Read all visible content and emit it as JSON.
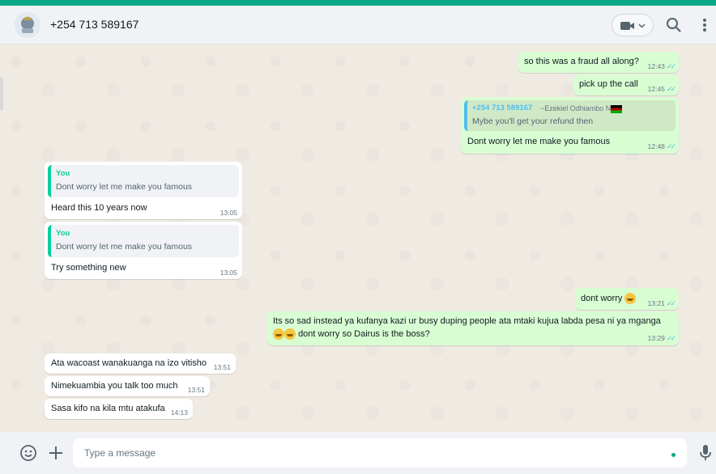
{
  "header": {
    "contact_name": "+254 713 589167",
    "icons": [
      "avatar-emblem",
      "video-call-icon",
      "chevron-down-icon",
      "search-icon",
      "menu-icon"
    ]
  },
  "messages": [
    {
      "direction": "outgoing",
      "text": "so this was a fraud all along?",
      "time": "12:43",
      "status": "read"
    },
    {
      "direction": "outgoing",
      "text": "pick up the call",
      "time": "12:45",
      "status": "read"
    },
    {
      "direction": "outgoing",
      "quote": {
        "author": "+254 713 589167",
        "name": "~Ezekiel Odhiambo N",
        "text": "Mybe you'll get your refund then"
      },
      "text": "Dont worry let me  make you famous",
      "time": "12:48",
      "status": "read"
    },
    {
      "direction": "incoming",
      "quote": {
        "author": "You",
        "text": "Dont worry let me  make you famous"
      },
      "text": "Heard this 10 years now",
      "time": "13:05"
    },
    {
      "direction": "incoming",
      "quote": {
        "author": "You",
        "text": "Dont worry let me  make you famous"
      },
      "text": "Try something new",
      "time": "13:05"
    },
    {
      "direction": "outgoing",
      "text": "dont worry",
      "time": "13:21",
      "status": "read"
    },
    {
      "direction": "outgoing",
      "text_line1": "Its so sad instead ya kufanya kazi ur busy duping people ata mtaki kujua labda pesa ni ya mganga",
      "text_line2": "dont worry so Dairus is the boss?",
      "time": "13:29",
      "status": "read"
    },
    {
      "direction": "incoming",
      "text": "Ata wacoast wanakuanga na izo vitisho",
      "time": "13:51"
    },
    {
      "direction": "incoming",
      "text": "Nimekuambia you talk too much",
      "time": "13:51"
    },
    {
      "direction": "incoming",
      "text": "Sasa kifo na kila mtu atakufa",
      "time": "14:13"
    }
  ],
  "composer": {
    "placeholder": "Type a message",
    "icons": [
      "emoji-icon",
      "attach-plus-icon",
      "microphone-icon"
    ]
  },
  "colors": {
    "accent": "#00a884",
    "outgoing_bubble": "#d9fdd3",
    "incoming_bubble": "#ffffff",
    "chat_background": "#efeae2",
    "read_tick": "#53bdeb"
  }
}
